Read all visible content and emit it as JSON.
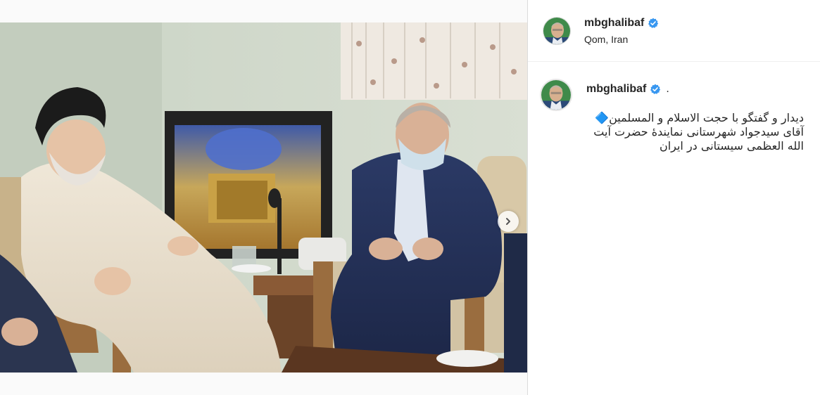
{
  "header": {
    "username": "mbghalibaf",
    "location": "Qom, Iran"
  },
  "comment": {
    "username": "mbghalibaf",
    "separator": ".",
    "caption": "دیدار و گفتگو با حجت الاسلام و المسلمین🔷 آقای سیدجواد شهرستانی نمایندهٔ حضرت آیت الله العظمی سیستانی در ایران"
  },
  "carousel": {
    "slide_count": 4,
    "active_index": 0
  },
  "colors": {
    "verified": "#3897f0",
    "text": "#262626",
    "border": "#dbdbdb"
  },
  "icons": {
    "verified": "verified-badge-icon",
    "next": "chevron-right-icon"
  }
}
